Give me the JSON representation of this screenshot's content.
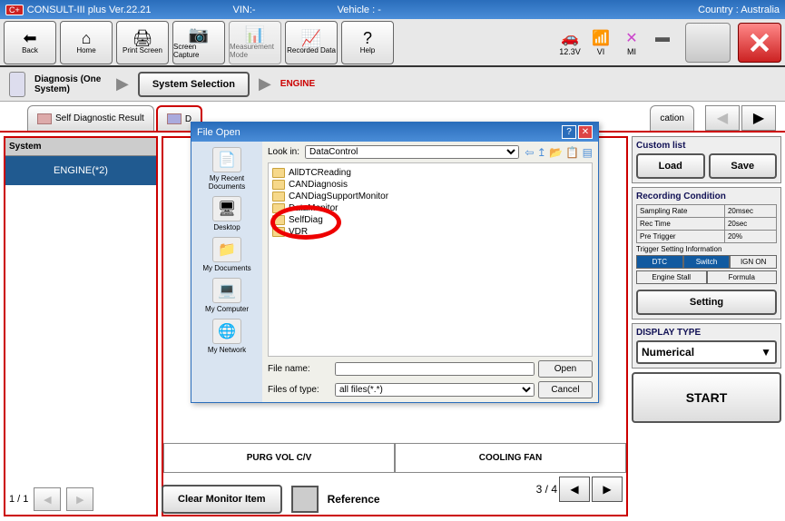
{
  "titlebar": {
    "badge": "C+",
    "app": "CONSULT-III plus  Ver.22.21",
    "vin_label": "VIN:-",
    "vehicle_label": "Vehicle : -",
    "country_label": "Country : Australia"
  },
  "toolbar": {
    "back": "Back",
    "home": "Home",
    "print": "Print Screen",
    "screen_capture": "Screen Capture",
    "measurement": "Measurement Mode",
    "recorded": "Recorded Data",
    "help": "Help",
    "voltage": "12.3V",
    "vi": "VI",
    "mi": "MI"
  },
  "breadcrumb": {
    "diag": "Diagnosis (One System)",
    "sys_sel": "System Selection",
    "engine": "ENGINE"
  },
  "tabs": {
    "self_diag": "Self Diagnostic Result",
    "d_prefix": "D",
    "cation": "cation"
  },
  "left": {
    "system": "System",
    "engine": "ENGINE(*2)",
    "page": "1 / 1"
  },
  "center": {
    "cell1": "PURG VOL C/V",
    "cell2": "COOLING FAN",
    "page": "3 / 4",
    "clear": "Clear Monitor Item",
    "reference": "Reference"
  },
  "right": {
    "custom_list": "Custom list",
    "load": "Load",
    "save": "Save",
    "rec_cond": "Recording Condition",
    "sampling_rate_l": "Sampling Rate",
    "sampling_rate_v": "20msec",
    "rec_time_l": "Rec Time",
    "rec_time_v": "20sec",
    "pre_trigger_l": "Pre Trigger",
    "pre_trigger_v": "20%",
    "trig_info": "Trigger Setting Information",
    "dtc": "DTC",
    "switch": "Switch",
    "ign": "IGN ON",
    "engine_stall": "Engine Stall",
    "formula": "Formula",
    "setting": "Setting",
    "display_type": "DISPLAY TYPE",
    "numerical": "Numerical",
    "start": "START"
  },
  "file_dlg": {
    "title": "File Open",
    "look_in": "Look in:",
    "folder": "DataControl",
    "items": [
      "AllDTCReading",
      "CANDiagnosis",
      "CANDiagSupportMonitor",
      "DataMonitor",
      "SelfDiag",
      "VDR"
    ],
    "places": [
      "My Recent Documents",
      "Desktop",
      "My Documents",
      "My Computer",
      "My Network"
    ],
    "file_name_l": "File name:",
    "file_name_v": "",
    "file_type_l": "Files of type:",
    "file_type_v": "all files(*.*)",
    "open": "Open",
    "cancel": "Cancel"
  }
}
